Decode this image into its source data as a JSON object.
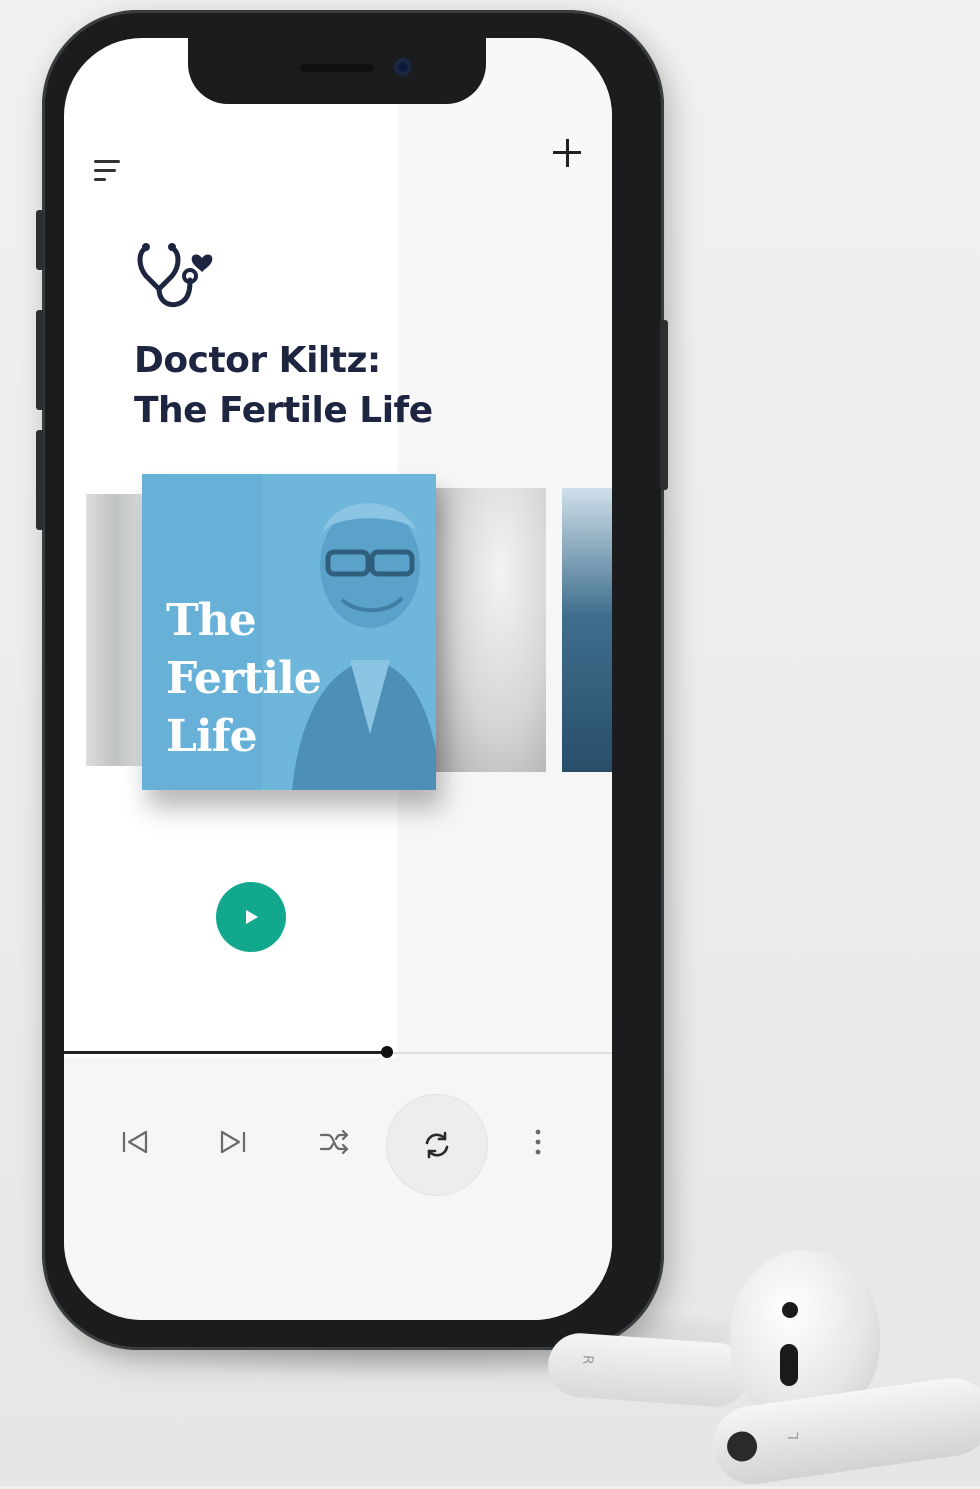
{
  "podcast": {
    "title": "Doctor Kiltz:\nThe Fertile Life",
    "album_text": "The\nFertile\nLife"
  },
  "player": {
    "progress_percent": 59
  },
  "earbuds": {
    "right_label": "R",
    "left_label": "L"
  },
  "colors": {
    "accent": "#12a88e",
    "title": "#1d2540",
    "album_bg": "#67b1d8"
  },
  "icons": {
    "menu": "menu-icon",
    "add": "plus-icon",
    "logo": "stethoscope-heart-icon",
    "play": "play-icon",
    "previous": "skip-previous-icon",
    "next": "skip-next-icon",
    "shuffle": "shuffle-icon",
    "repeat": "repeat-icon",
    "more": "more-vertical-icon"
  }
}
